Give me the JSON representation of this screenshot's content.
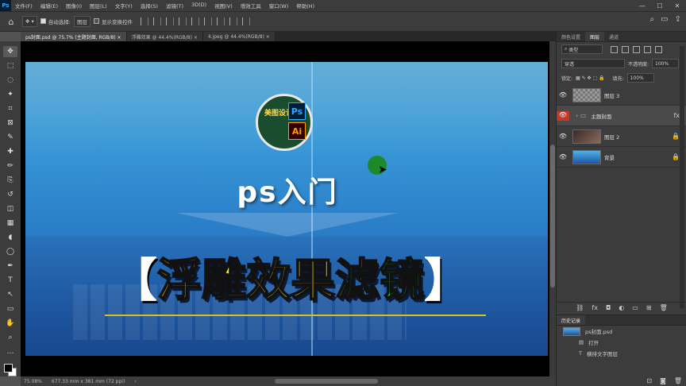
{
  "app": {
    "logo": "Ps"
  },
  "menu": [
    "文件(F)",
    "编辑(E)",
    "图像(I)",
    "图层(L)",
    "文字(Y)",
    "选择(S)",
    "滤镜(T)",
    "3D(D)",
    "视图(V)",
    "增效工具",
    "窗口(W)",
    "帮助(H)"
  ],
  "window_controls": {
    "minimize": "—",
    "maximize": "☐",
    "close": "✕"
  },
  "options": {
    "auto_select_label": "自动选择:",
    "layer_select": "图层",
    "transform_label": "显示变换控件"
  },
  "tabs": [
    {
      "label": "ps封面.psd @ 75.7% (主题封面, RGB/8) ×",
      "active": true
    },
    {
      "label": "浮雕效果 @ 44.4%(RGB/8) ×",
      "active": false
    },
    {
      "label": "4.jpeg @ 44.4%(RGB/8) ×",
      "active": false
    }
  ],
  "tools": [
    "move-icon",
    "marquee-icon",
    "lasso-icon",
    "magic-wand-icon",
    "crop-icon",
    "frame-icon",
    "eyedropper-icon",
    "healing-icon",
    "brush-icon",
    "clone-stamp-icon",
    "history-brush-icon",
    "eraser-icon",
    "gradient-icon",
    "blur-icon",
    "dodge-icon",
    "pen-icon",
    "type-icon",
    "path-select-icon",
    "shape-icon",
    "hand-icon",
    "zoom-icon",
    "more-icon"
  ],
  "canvas": {
    "logo_ps": "Ps",
    "logo_ai": "Ai",
    "logo_text": "美图设计",
    "subtitle": "ps入门",
    "bracket_left": "【",
    "bracket_right": "】",
    "title_chars": [
      {
        "char": "浮",
        "color": "yellow"
      },
      {
        "char": "雕",
        "color": "yellow"
      },
      {
        "char": "效",
        "color": "yellow"
      },
      {
        "char": "果",
        "color": "yellow"
      },
      {
        "char": "滤",
        "color": "green"
      },
      {
        "char": "镜",
        "color": "green"
      }
    ]
  },
  "status": {
    "zoom": "75.08%",
    "doc_size": "677.33 mm x 381 mm (72 ppi)"
  },
  "layers_panel": {
    "tabs": [
      "颜色设置",
      "图层",
      "通道"
    ],
    "kind": "类型",
    "blend_mode": "穿透",
    "opacity_label": "不透明度:",
    "opacity_value": "100%",
    "lock_label": "锁定:",
    "fill_label": "填充:",
    "fill_value": "100%",
    "layers": [
      {
        "name": "图层 3",
        "thumb": "trans",
        "visible": true,
        "selected": false,
        "right": ""
      },
      {
        "name": "主题封面",
        "thumb": "folder",
        "visible": true,
        "selected": true,
        "right": "fx"
      },
      {
        "name": "图层 2",
        "thumb": "img",
        "visible": true,
        "selected": false,
        "right": "🔒"
      },
      {
        "name": "背景",
        "thumb": "blue",
        "visible": true,
        "selected": false,
        "right": "🔒"
      }
    ]
  },
  "history_panel": {
    "tabs": [
      "历史记录"
    ],
    "items": [
      {
        "label": "ps封面.psd",
        "icon": "thumb"
      },
      {
        "label": "打开",
        "icon": "doc"
      },
      {
        "label": "横排文字图层",
        "icon": "T"
      }
    ]
  }
}
